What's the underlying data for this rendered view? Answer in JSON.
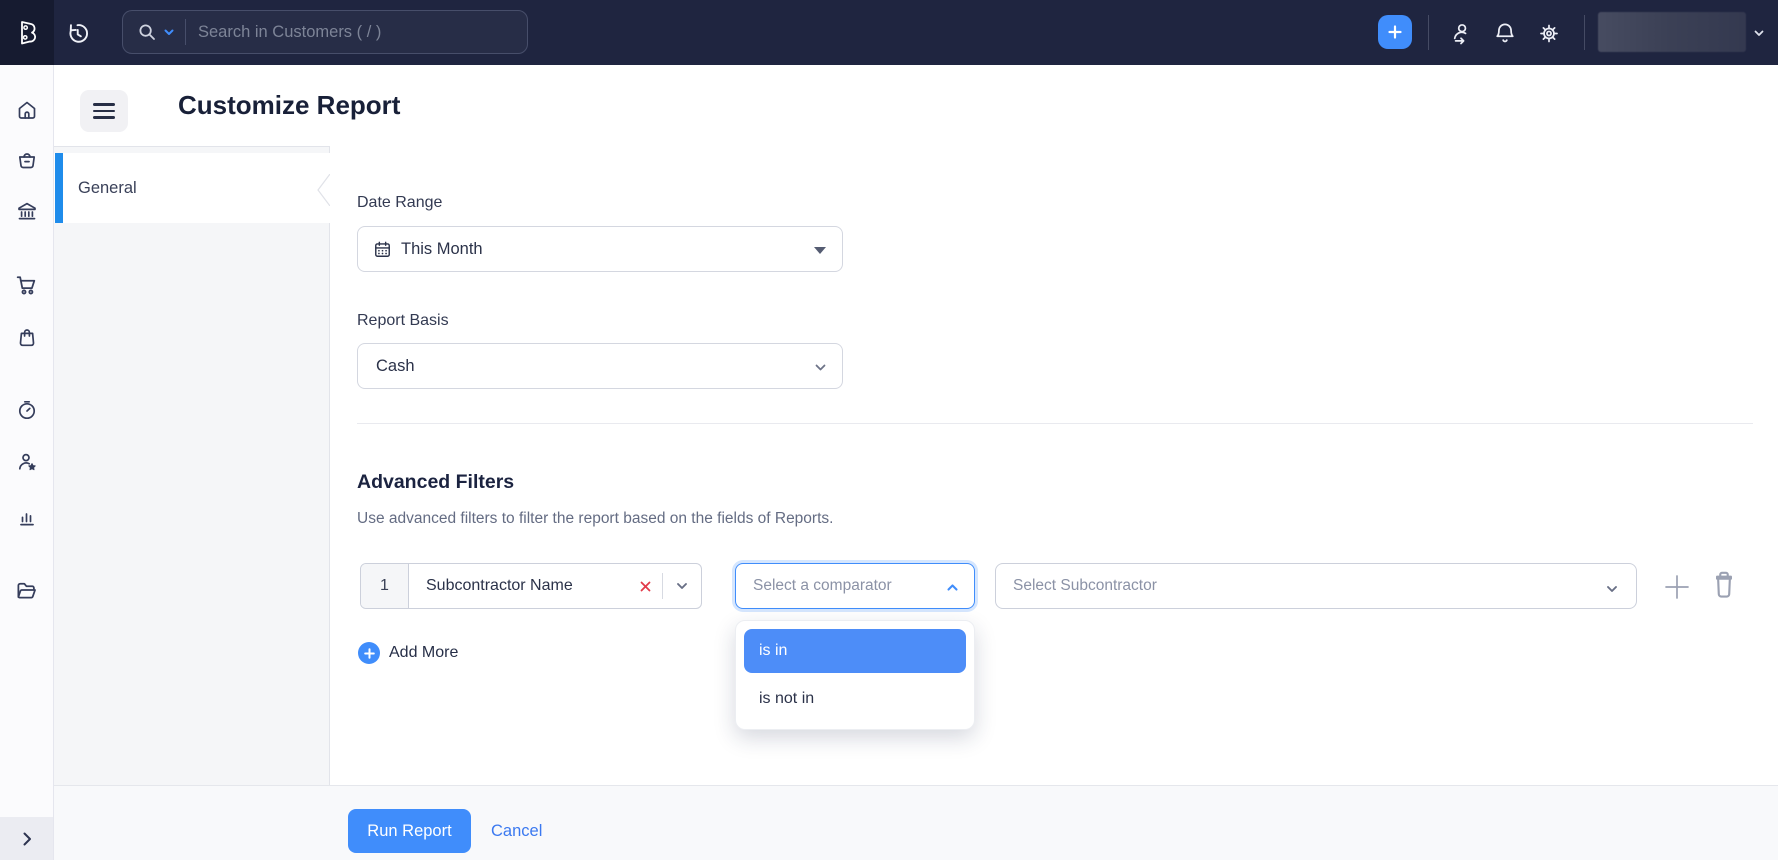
{
  "navbar": {
    "search_placeholder": "Search in Customers ( / )",
    "icons": [
      "books-logo-icon",
      "history-icon",
      "search-icon",
      "search-scope-caret-icon",
      "quick-create-plus-icon",
      "referrals-icon",
      "notifications-bell-icon",
      "settings-gear-icon",
      "org-dropdown-caret-icon"
    ]
  },
  "sidebar": {
    "icons": [
      "home-icon",
      "items-icon",
      "banking-icon",
      "sales-cart-icon",
      "purchases-bag-icon",
      "time-tracking-icon",
      "accountant-icon",
      "reports-icon",
      "documents-icon",
      "expand-chevron-icon"
    ]
  },
  "header": {
    "title": "Customize Report"
  },
  "panel": {
    "active_tab": "General"
  },
  "form": {
    "date_range_label": "Date Range",
    "date_range_value": "This Month",
    "report_basis_label": "Report Basis",
    "report_basis_value": "Cash",
    "advanced_filters_title": "Advanced Filters",
    "advanced_filters_desc": "Use advanced filters to filter the report based on the fields of Reports.",
    "filter_row": {
      "index": "1",
      "field_value": "Subcontractor Name",
      "comparator_placeholder": "Select a comparator",
      "comparator_options": [
        "is in",
        "is not in"
      ],
      "value_placeholder": "Select Subcontractor"
    },
    "add_more_label": "Add More"
  },
  "footer": {
    "run_label": "Run Report",
    "cancel_label": "Cancel"
  },
  "colors": {
    "accent": "#408dfb",
    "option_highlight": "#4d8df8",
    "active_tab_bar": "#1f8ceb",
    "danger": "#e23b4a",
    "navbar_bg": "#1f2540"
  }
}
